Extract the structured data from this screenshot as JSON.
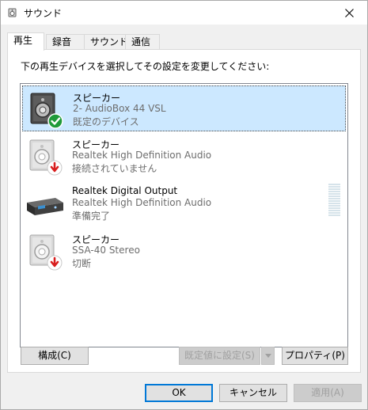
{
  "window": {
    "title": "サウンド",
    "icon": "speaker-icon"
  },
  "tabs": [
    {
      "label": "再生",
      "active": true
    },
    {
      "label": "録音",
      "active": false
    },
    {
      "label": "サウンド",
      "active": false
    },
    {
      "label": "通信",
      "active": false
    }
  ],
  "instruction": "下の再生デバイスを選択してその設定を変更してください:",
  "devices": [
    {
      "name": "スピーカー",
      "line2": "2- AudioBox 44 VSL",
      "status": "既定のデバイス",
      "icon": "speaker-default-check-icon",
      "selected": true
    },
    {
      "name": "スピーカー",
      "line2": "Realtek High Definition Audio",
      "status": "接続されていません",
      "icon": "speaker-disconnected-icon",
      "selected": false
    },
    {
      "name": "Realtek Digital Output",
      "line2": "Realtek High Definition Audio",
      "status": "準備完了",
      "icon": "digital-output-icon",
      "selected": false
    },
    {
      "name": "スピーカー",
      "line2": "SSA-40 Stereo",
      "status": "切断",
      "icon": "speaker-disconnected-icon",
      "selected": false
    }
  ],
  "buttons": {
    "configure": "構成(C)",
    "set_default": "既定値に設定(S)",
    "properties": "プロパティ(P)",
    "ok": "OK",
    "cancel": "キャンセル",
    "apply": "適用(A)"
  },
  "colors": {
    "selection": "#cce8ff",
    "focus_accent": "#0078d7",
    "check_green": "#1f9a3a",
    "alert_red": "#d81e1e"
  }
}
